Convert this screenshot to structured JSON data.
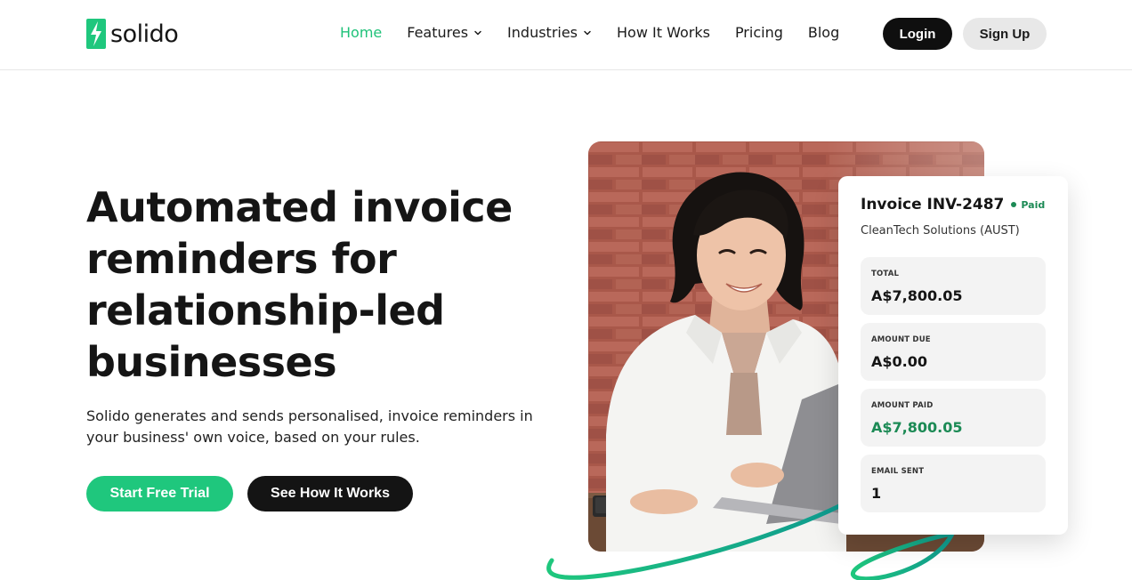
{
  "brand": {
    "name": "solido"
  },
  "nav": {
    "items": [
      {
        "label": "Home",
        "active": true,
        "dropdown": false
      },
      {
        "label": "Features",
        "active": false,
        "dropdown": true
      },
      {
        "label": "Industries",
        "active": false,
        "dropdown": true
      },
      {
        "label": "How It Works",
        "active": false,
        "dropdown": false
      },
      {
        "label": "Pricing",
        "active": false,
        "dropdown": false
      },
      {
        "label": "Blog",
        "active": false,
        "dropdown": false
      }
    ],
    "login_label": "Login",
    "signup_label": "Sign Up"
  },
  "hero": {
    "title": "Automated invoice reminders for relationship-led businesses",
    "subtitle": "Solido generates and sends personalised, invoice reminders in your business' own voice, based on your rules.",
    "primary_cta": "Start Free Trial",
    "secondary_cta": "See How It Works"
  },
  "invoice": {
    "title": "Invoice INV-2487",
    "status": "Paid",
    "company": "CleanTech Solutions (AUST)",
    "stats": [
      {
        "label": "TOTAL",
        "value": "A$7,800.05",
        "highlight": false
      },
      {
        "label": "AMOUNT DUE",
        "value": "A$0.00",
        "highlight": false
      },
      {
        "label": "AMOUNT PAID",
        "value": "A$7,800.05",
        "highlight": true
      },
      {
        "label": "EMAIL SENT",
        "value": "1",
        "highlight": false
      }
    ]
  },
  "icons": {
    "logo": "solido-logo-icon",
    "dropdown": "chevron-down-icon"
  },
  "colors": {
    "accent": "#1fc77d",
    "dark": "#141414",
    "paid": "#1c8a55",
    "swoosh": "#14b38a"
  }
}
